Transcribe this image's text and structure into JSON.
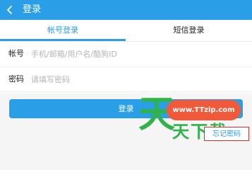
{
  "header": {
    "title": "登录",
    "back_icon": "chevron-left-icon",
    "background_color": "#2a9fe8"
  },
  "tabs": [
    {
      "label": "帐号登录",
      "active": true
    },
    {
      "label": "短信登录",
      "active": false
    }
  ],
  "form": {
    "account": {
      "label": "帐号",
      "placeholder": "手机/邮箱/用户名/酷狗ID",
      "value": ""
    },
    "password": {
      "label": "密码",
      "placeholder": "请填写密码",
      "value": ""
    }
  },
  "login_button": {
    "label": "登录"
  },
  "forgot_password": {
    "label": "忘记密码",
    "highlight_color": "#c0392b"
  },
  "watermark": {
    "url": "www.TTzip.com",
    "big_char": "天",
    "small_chars": "天下载",
    "accent_color": "#2fb34a"
  }
}
